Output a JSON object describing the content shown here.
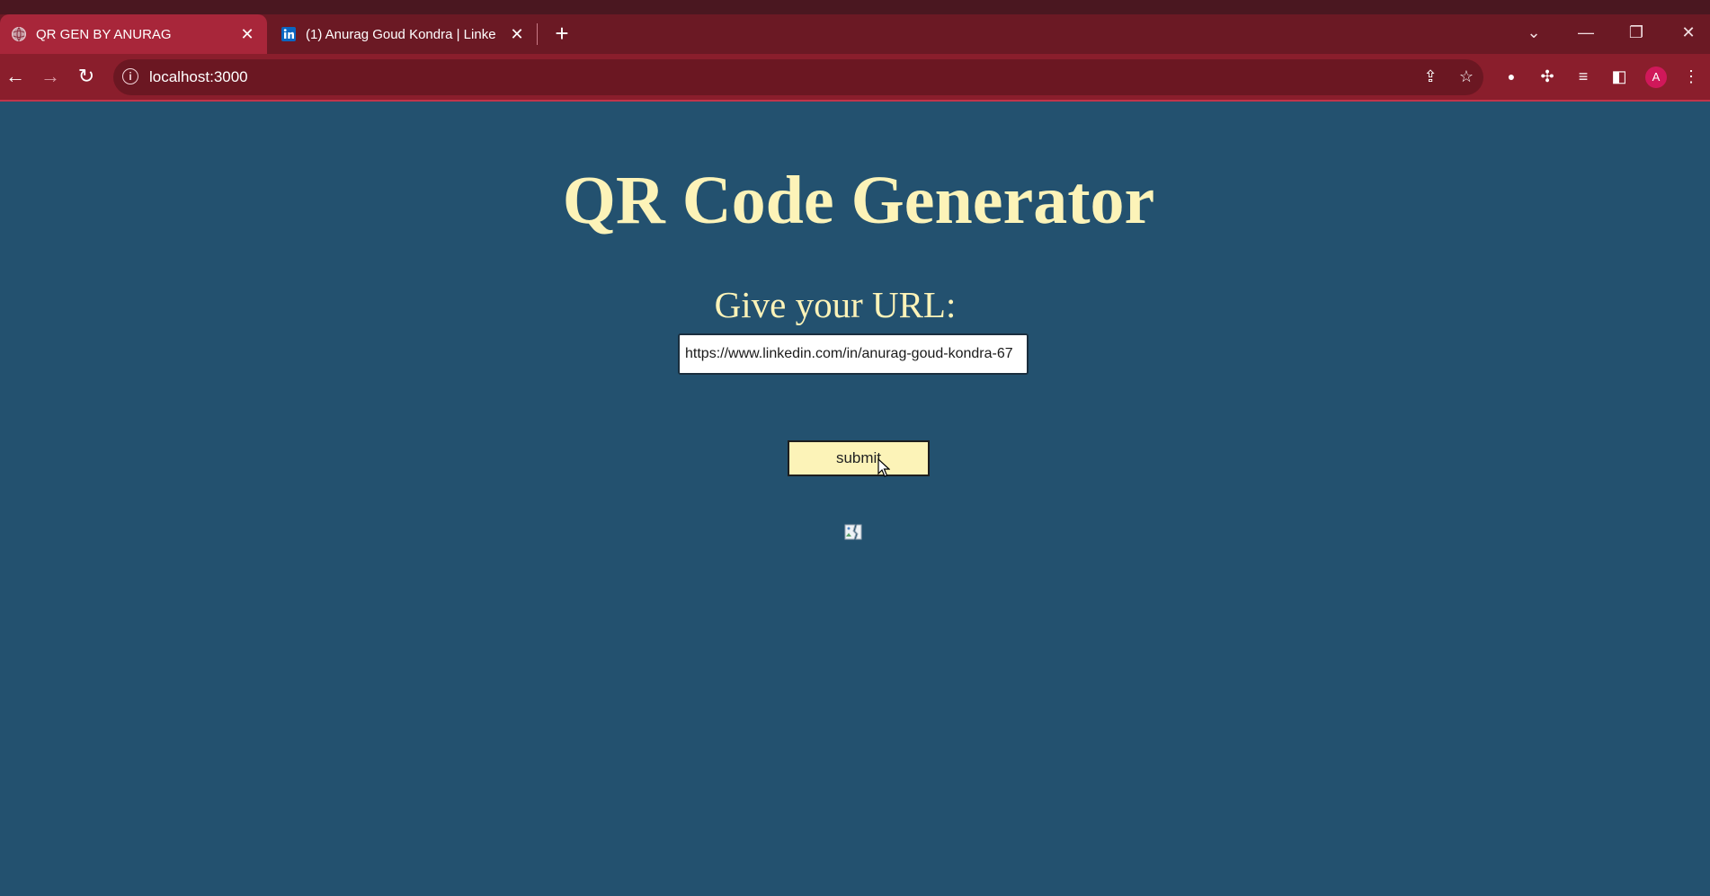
{
  "browser": {
    "tabs": [
      {
        "title": "QR GEN BY ANURAG",
        "active": true,
        "favicon": "globe-icon"
      },
      {
        "title": "(1) Anurag Goud Kondra | Linke",
        "active": false,
        "favicon": "linkedin-icon"
      }
    ],
    "new_tab_label": "+",
    "address": "localhost:3000",
    "profile_initial": "A",
    "colors": {
      "tabstrip": "#6b1924",
      "active_tab": "#a8263a",
      "toolbar": "#8a1e2c"
    }
  },
  "page": {
    "title": "QR Code Generator",
    "url_label": "Give your URL:",
    "url_value": "https://www.linkedin.com/in/anurag-goud-kondra-67",
    "submit_label": "submit",
    "qr_image": "broken-image-icon",
    "colors": {
      "background": "#23516f",
      "text": "#fcf3b8",
      "button": "#fcf3b8"
    }
  }
}
